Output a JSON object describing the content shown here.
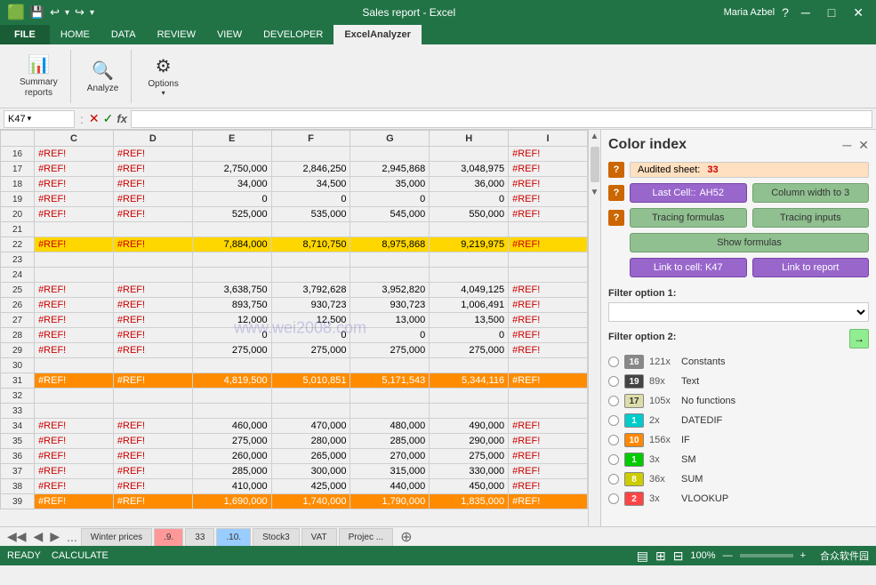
{
  "titlebar": {
    "title": "Sales report - Excel",
    "user": "Maria Azbel",
    "save_icon": "💾",
    "undo_icon": "↩",
    "redo_icon": "↪"
  },
  "ribbon": {
    "tabs": [
      "FILE",
      "HOME",
      "DATA",
      "REVIEW",
      "VIEW",
      "DEVELOPER",
      "ExcelAnalyzer"
    ],
    "active_tab": "ExcelAnalyzer",
    "buttons": [
      "Summary reports",
      "Analyze",
      "Options"
    ]
  },
  "formula_bar": {
    "cell_ref": "K47",
    "formula": ""
  },
  "spreadsheet": {
    "columns": [
      "C",
      "D",
      "E",
      "F",
      "G",
      "H",
      "I"
    ],
    "rows": [
      {
        "num": 16,
        "cells": [
          "#REF!",
          "#REF!",
          "",
          "",
          "",
          "",
          "#REF!"
        ]
      },
      {
        "num": 17,
        "cells": [
          "#REF!",
          "#REF!",
          "2,750,000",
          "2,846,250",
          "2,945,868",
          "3,048,975",
          "#REF!"
        ]
      },
      {
        "num": 18,
        "cells": [
          "#REF!",
          "#REF!",
          "34,000",
          "34,500",
          "35,000",
          "36,000",
          "#REF!"
        ]
      },
      {
        "num": 19,
        "cells": [
          "#REF!",
          "#REF!",
          "0",
          "0",
          "0",
          "0",
          "#REF!"
        ]
      },
      {
        "num": 20,
        "cells": [
          "#REF!",
          "#REF!",
          "525,000",
          "535,000",
          "545,000",
          "550,000",
          "#REF!"
        ]
      },
      {
        "num": 21,
        "cells": [
          "",
          "",
          "",
          "",
          "",
          "",
          ""
        ]
      },
      {
        "num": 22,
        "cells": [
          "#REF!",
          "#REF!",
          "7,884,000",
          "8,710,750",
          "8,975,868",
          "9,219,975",
          "#REF!"
        ],
        "highlight": "yellow"
      },
      {
        "num": 23,
        "cells": [
          "",
          "",
          "",
          "",
          "",
          "",
          ""
        ]
      },
      {
        "num": 24,
        "cells": [
          "",
          "",
          "",
          "",
          "",
          "",
          ""
        ]
      },
      {
        "num": 25,
        "cells": [
          "#REF!",
          "#REF!",
          "3,638,750",
          "3,792,628",
          "3,952,820",
          "4,049,125",
          "#REF!"
        ]
      },
      {
        "num": 26,
        "cells": [
          "#REF!",
          "#REF!",
          "893,750",
          "930,723",
          "930,723",
          "1,006,491",
          "#REF!"
        ]
      },
      {
        "num": 27,
        "cells": [
          "#REF!",
          "#REF!",
          "12,000",
          "12,500",
          "13,000",
          "13,500",
          "#REF!"
        ]
      },
      {
        "num": 28,
        "cells": [
          "#REF!",
          "#REF!",
          "0",
          "0",
          "0",
          "0",
          "#REF!"
        ]
      },
      {
        "num": 29,
        "cells": [
          "#REF!",
          "#REF!",
          "275,000",
          "275,000",
          "275,000",
          "275,000",
          "#REF!"
        ]
      },
      {
        "num": 30,
        "cells": [
          "",
          "",
          "",
          "",
          "",
          "",
          ""
        ]
      },
      {
        "num": 31,
        "cells": [
          "#REF!",
          "#REF!",
          "4,819,500",
          "5,010,851",
          "5,171,543",
          "5,344,116",
          "#REF!"
        ],
        "highlight": "orange"
      },
      {
        "num": 32,
        "cells": [
          "",
          "",
          "",
          "",
          "",
          "",
          ""
        ]
      },
      {
        "num": 33,
        "cells": [
          "",
          "",
          "",
          "",
          "",
          "",
          ""
        ]
      },
      {
        "num": 34,
        "cells": [
          "#REF!",
          "#REF!",
          "460,000",
          "470,000",
          "480,000",
          "490,000",
          "#REF!"
        ]
      },
      {
        "num": 35,
        "cells": [
          "#REF!",
          "#REF!",
          "275,000",
          "280,000",
          "285,000",
          "290,000",
          "#REF!"
        ]
      },
      {
        "num": 36,
        "cells": [
          "#REF!",
          "#REF!",
          "260,000",
          "265,000",
          "270,000",
          "275,000",
          "#REF!"
        ]
      },
      {
        "num": 37,
        "cells": [
          "#REF!",
          "#REF!",
          "285,000",
          "300,000",
          "315,000",
          "330,000",
          "#REF!"
        ]
      },
      {
        "num": 38,
        "cells": [
          "#REF!",
          "#REF!",
          "410,000",
          "425,000",
          "440,000",
          "450,000",
          "#REF!"
        ]
      },
      {
        "num": 39,
        "cells": [
          "#REF!",
          "#REF!",
          "1,690,000",
          "1,740,000",
          "1,790,000",
          "1,835,000",
          "#REF!"
        ],
        "highlight": "orange"
      }
    ]
  },
  "sheet_tabs": [
    {
      "name": "Winter prices",
      "active": false
    },
    {
      "name": ".9.",
      "active": false,
      "color": "pink"
    },
    {
      "name": "33",
      "active": false
    },
    {
      "name": ".10.",
      "active": false,
      "color": "blue"
    },
    {
      "name": "Stock3",
      "active": false
    },
    {
      "name": "VAT",
      "active": false
    },
    {
      "name": "Projec...",
      "active": false
    }
  ],
  "status_bar": {
    "ready": "READY",
    "calculate": "CALCULATE"
  },
  "color_panel": {
    "title": "Color index",
    "audited_sheet_label": "Audited sheet:",
    "audited_sheet_value": "33",
    "last_cell_label": "Last Cell:",
    "last_cell_value": "AH52",
    "column_width_label": "Column width to 3",
    "tracing_formulas_label": "Tracing formulas",
    "tracing_inputs_label": "Tracing inputs",
    "show_formulas_label": "Show formulas",
    "link_to_cell_label": "Link to cell: K47",
    "link_to_report_label": "Link to report",
    "filter1_label": "Filter option 1:",
    "filter2_label": "Filter option 2:",
    "filter_items": [
      {
        "color": "#888888",
        "num": "16",
        "count": "121x",
        "name": "Constants"
      },
      {
        "color": "#444444",
        "num": "19",
        "count": "89x",
        "name": "Text"
      },
      {
        "color": "#ddddaa",
        "num": "17",
        "count": "105x",
        "name": "No functions",
        "light": true
      },
      {
        "color": "#00CCCC",
        "num": "1",
        "count": "2x",
        "name": "DATEDIF"
      },
      {
        "color": "#FF8800",
        "num": "10",
        "count": "156x",
        "name": "IF"
      },
      {
        "color": "#00CC00",
        "num": "1",
        "count": "3x",
        "name": "SM"
      },
      {
        "color": "#CCCC00",
        "num": "8",
        "count": "36x",
        "name": "SUM"
      },
      {
        "color": "#FF4444",
        "num": "2",
        "count": "3x",
        "name": "VLOOKUP"
      }
    ]
  },
  "watermark": "www.wei2008.com"
}
